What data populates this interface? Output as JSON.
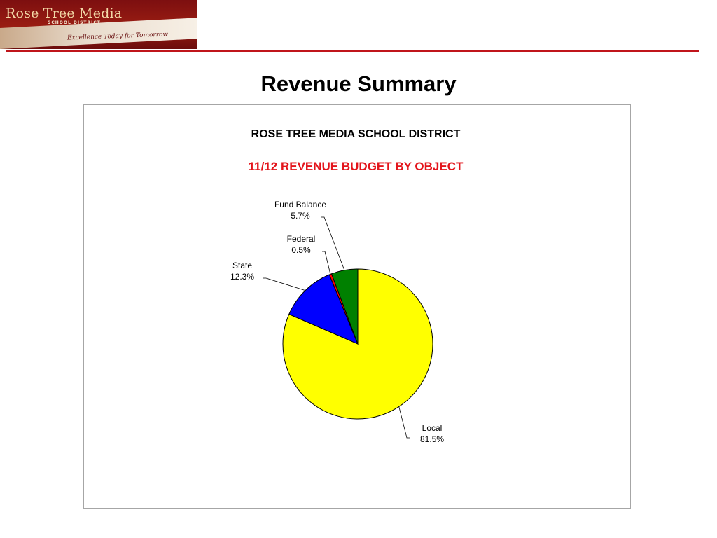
{
  "logo": {
    "name": "Rose Tree Media",
    "subtitle": "SCHOOL DISTRICT",
    "tagline": "Excellence Today for Tomorrow"
  },
  "page": {
    "title": "Revenue Summary"
  },
  "colors": {
    "accent_rule": "#c0151b",
    "subtitle_text": "#e3141b"
  },
  "chart_data": {
    "type": "pie",
    "title": "ROSE TREE MEDIA SCHOOL DISTRICT",
    "subtitle": "11/12  REVENUE BUDGET BY OBJECT",
    "start_angle_deg": 0,
    "direction": "clockwise",
    "slices": [
      {
        "label": "Local",
        "value": 81.5,
        "value_label": "81.5%",
        "color": "#ffff00"
      },
      {
        "label": "State",
        "value": 12.3,
        "value_label": "12.3%",
        "color": "#0000ff"
      },
      {
        "label": "Federal",
        "value": 0.5,
        "value_label": "0.5%",
        "color": "#ff0000"
      },
      {
        "label": "Fund Balance",
        "value": 5.7,
        "value_label": "5.7%",
        "color": "#008000"
      }
    ],
    "legend": "none"
  }
}
